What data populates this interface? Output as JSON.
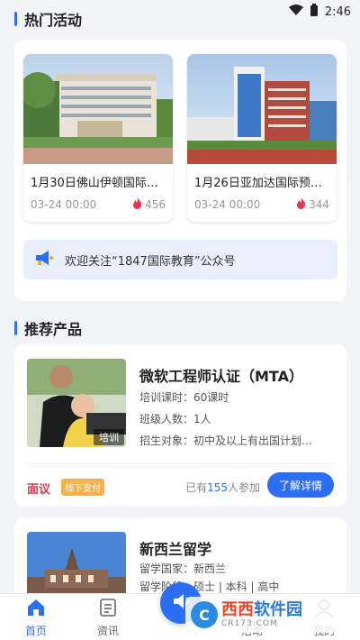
{
  "status_bar": {
    "time": "2:46"
  },
  "hot_section": {
    "title": "热门活动",
    "activities": [
      {
        "title": "1月30日佛山伊顿国际…",
        "date": "03-24 00:00",
        "views": "456"
      },
      {
        "title": "1月26日亚加达国际预…",
        "date": "03-24 00:00",
        "views": "344"
      }
    ],
    "notice": "欢迎关注“1847国际教育”公众号"
  },
  "products_section": {
    "title": "推荐产品",
    "items": [
      {
        "title": "微软工程师认证（MTA）",
        "lines": [
          "培训课时：60课时",
          "班级人数：1人",
          "招生对象：初中及以上有出国计划…"
        ],
        "image_tag": "培训",
        "price": "面议",
        "pay_tag": "线下支付",
        "joined_prefix": "已有",
        "joined_count": "155",
        "joined_suffix": "人参加",
        "detail_label": "了解详情"
      },
      {
        "title": "新西兰留学",
        "lines": [
          "留学国家：新西兰",
          "留学阶段：硕士 | 本科 | 高中"
        ]
      }
    ]
  },
  "tabbar": {
    "tabs": [
      {
        "label": "首页",
        "icon": "home-icon"
      },
      {
        "label": "资讯",
        "icon": "news-icon"
      },
      {
        "label": "活动",
        "icon": "activity-icon"
      },
      {
        "label": "我的",
        "icon": "profile-icon"
      }
    ]
  },
  "watermark": {
    "main_red": "西西",
    "main_blue": "软件园",
    "sub": "CR173.COM"
  },
  "colors": {
    "accent": "#2d6ff2",
    "price": "#e03a4a",
    "pay_tag": "#f6b24a",
    "notice_bg": "#e8eefc"
  }
}
